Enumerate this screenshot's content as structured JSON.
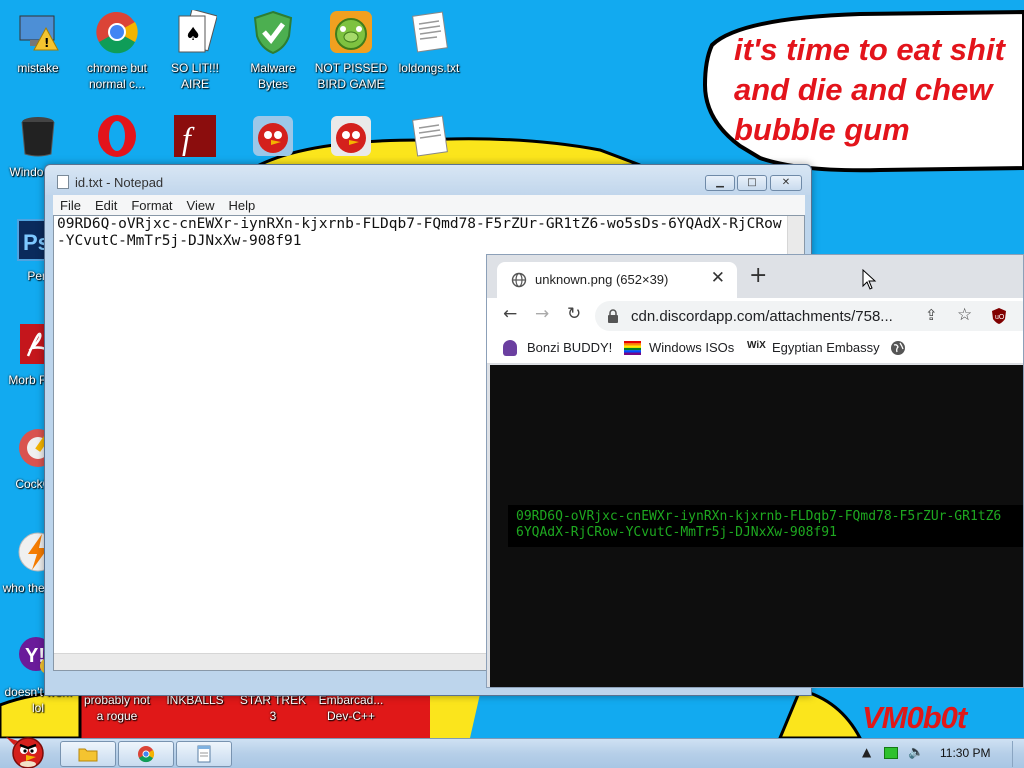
{
  "wallpaper": {
    "speech_lines": [
      "it's time to eat shit",
      "and die and chew",
      "bubble gum"
    ],
    "signature": "VM0b0t"
  },
  "desktop_icons": [
    {
      "label": "mistake",
      "icon": "computer-warning-icon"
    },
    {
      "label": "chrome but normal c...",
      "icon": "chrome-icon"
    },
    {
      "label": "SO LIT!!! AIRE",
      "icon": "solitaire-icon"
    },
    {
      "label": "Malware Bytes",
      "icon": "shield-check-icon"
    },
    {
      "label": "NOT PISSED BIRD GAME",
      "icon": "green-pig-icon"
    },
    {
      "label": "loldongs.txt",
      "icon": "text-file-icon"
    },
    {
      "label": "Windo Vist",
      "icon": "trash-can-icon"
    },
    {
      "label": "",
      "icon": "opera-icon"
    },
    {
      "label": "",
      "icon": "flash-icon"
    },
    {
      "label": "",
      "icon": "red-bird-icon"
    },
    {
      "label": "",
      "icon": "red-bird-icon"
    },
    {
      "label": "",
      "icon": "text-file-icon"
    },
    {
      "label": "Pen",
      "icon": "photoshop-icon"
    },
    {
      "label": "Morb Read",
      "icon": "acrobat-icon"
    },
    {
      "label": "CockCle",
      "icon": "ccleaner-icon"
    },
    {
      "label": "who the uses",
      "icon": "lightning-icon"
    },
    {
      "label": "doesn't work lol",
      "icon": "yahoo-icon"
    },
    {
      "label": "probably not a rogue",
      "icon": "generic-icon"
    },
    {
      "label": "INKBALLS",
      "icon": "generic-icon"
    },
    {
      "label": "STAR TREK 3",
      "icon": "generic-icon"
    },
    {
      "label": "Embarcad... Dev-C++",
      "icon": "generic-icon"
    }
  ],
  "notepad": {
    "title": "id.txt - Notepad",
    "menu": [
      "File",
      "Edit",
      "Format",
      "View",
      "Help"
    ],
    "content": "09RD6Q-oVRjxc-cnEWXr-iynRXn-kjxrnb-FLDqb7-FQmd78-F5rZUr-GR1tZ6-wo5sDs-6YQAdX-RjCRow-YCvutC-MmTr5j-DJNxXw-908f91"
  },
  "browser": {
    "tab_title": "unknown.png (652×39)",
    "url": "cdn.discordapp.com/attachments/758...",
    "bookmarks": [
      "Bonzi BUDDY!",
      "Windows ISOs",
      "Egyptian Embassy"
    ],
    "image_text_line1": "09RD6Q-oVRjxc-cnEWXr-iynRXn-kjxrnb-FLDqb7-FQmd78-F5rZUr-GR1tZ6",
    "image_text_line2": "6YQAdX-RjCRow-YCvutC-MmTr5j-DJNxXw-908f91"
  },
  "taskbar": {
    "clock": "11:30 PM"
  }
}
